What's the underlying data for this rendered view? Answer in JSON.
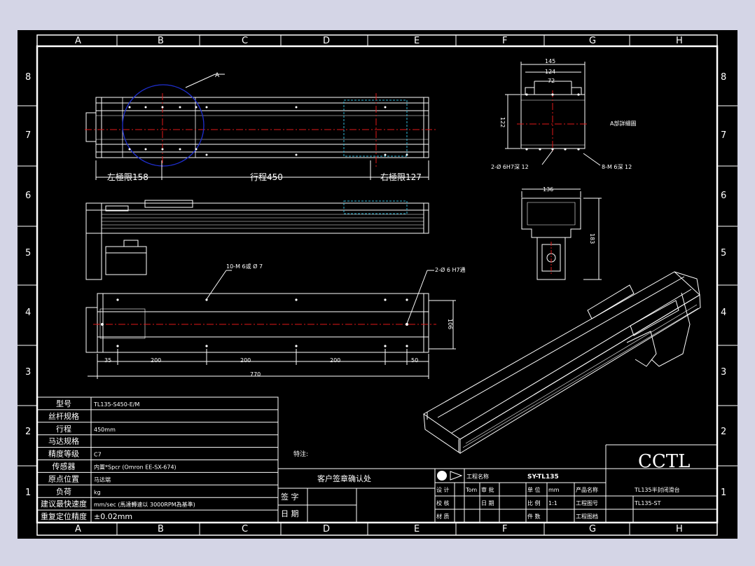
{
  "zone_letters": [
    "A",
    "B",
    "C",
    "D",
    "E",
    "F",
    "G",
    "H"
  ],
  "zone_numbers": [
    "8",
    "7",
    "6",
    "5",
    "4",
    "3",
    "2",
    "1"
  ],
  "annotations": {
    "detail_a_label": "A",
    "left_limit": "左極限158",
    "stroke": "行程450",
    "right_limit": "右極限127",
    "holes_10m": "10-M 6或 Ø 7",
    "holes_2d6": "2-Ø 6 H7通",
    "dim_106": "106",
    "dim_35": "35",
    "dim_200a": "200",
    "dim_200b": "200",
    "dim_200c": "200",
    "dim_50": "50",
    "dim_770": "770",
    "dim_145": "145",
    "dim_124": "124",
    "dim_72": "72",
    "dim_122": "122",
    "detail_a_title": "A部詳細圖",
    "pin_holes": "2-Ø 6H7深 12",
    "tap_holes": "8-M 6深 12",
    "dim_136": "136",
    "dim_183": "183"
  },
  "specs": [
    {
      "label": "型号",
      "value": "TL135-S450-E/M"
    },
    {
      "label": "丝杆规格",
      "value": ""
    },
    {
      "label": "行程",
      "value": "450mm"
    },
    {
      "label": "马达规格",
      "value": ""
    },
    {
      "label": "精度等级",
      "value": "C7"
    },
    {
      "label": "传感器",
      "value": "内置*Spcr (Omron EE-SX-674)"
    },
    {
      "label": "原点位置",
      "value": "马达端"
    },
    {
      "label": "负荷",
      "value": "kg"
    },
    {
      "label": "建议最快速度",
      "value": "mm/sec (馬達轉速以 3000RPM為基準)"
    },
    {
      "label": "重复定位精度",
      "value": "±0.02mm"
    }
  ],
  "remarks_label": "特注:",
  "customer": {
    "title": "客户签章确认处",
    "sign_label": "签 字",
    "date_label": "日 期"
  },
  "title_block": {
    "company_label": "工程名称",
    "drawing_no": "SY-TL135",
    "logo_text": "CCTL",
    "rows": [
      [
        "设 计",
        "Tom",
        "审 批",
        "",
        "单 位",
        "mm",
        "产品名称",
        "TL135半封闭滑台"
      ],
      [
        "校 核",
        "",
        "日 期",
        "",
        "比 例",
        "1:1",
        "工程图号",
        "TL135-ST"
      ],
      [
        "材 质",
        "",
        "",
        "",
        "件 数",
        "",
        "工程图档",
        ""
      ]
    ]
  },
  "colors": {
    "background": "#000000",
    "line": "#ffffff",
    "center_line": "#e01818",
    "detail_circle": "#1f2fd0",
    "hidden_line": "#2fb8d8",
    "viewport": "#d4d5e6"
  }
}
